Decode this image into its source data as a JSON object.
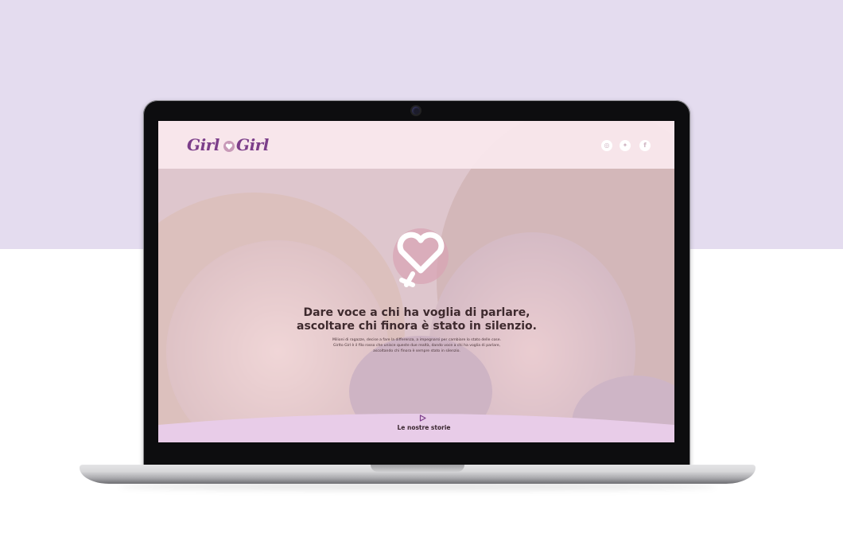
{
  "site": {
    "logo": {
      "word_left": "Girl",
      "word_right": "Girl"
    },
    "social": [
      {
        "icon": "instagram-icon",
        "glyph": "◎"
      },
      {
        "icon": "twitter-icon",
        "glyph": "✦"
      },
      {
        "icon": "facebook-icon",
        "glyph": "f"
      }
    ],
    "hero": {
      "headline_line1": "Dare voce a chi ha voglia di parlare,",
      "headline_line2": "ascoltare chi finora è stato in silenzio.",
      "paragraph": "Milioni di ragazze, decise a fare la differenza, a impegnarsi per cambiare lo stato delle cose. Girlto Girl è il filo rosso che unisce queste due realtà, dando voce a chi ha voglia di parlare, ascoltando chi finora è sempre stato in silenzio."
    },
    "cta": {
      "label": "Le nostre storie",
      "icon": "play-icon"
    }
  },
  "colors": {
    "background_top": "#e4dcef",
    "brand_purple": "#7c3e8a",
    "band_lilac": "#e8cce8"
  }
}
